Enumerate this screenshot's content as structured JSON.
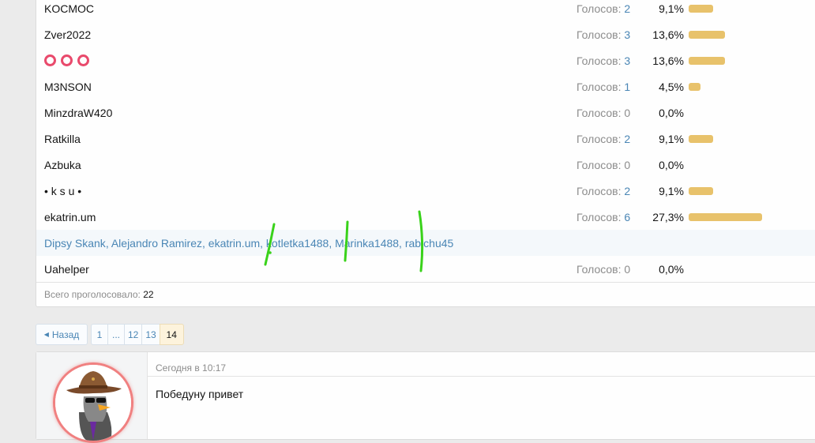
{
  "poll": {
    "votes_label": "Голосов:",
    "rows": [
      {
        "name": "KOCMOC",
        "count": "2",
        "pct": "9,1%",
        "share": 0.091
      },
      {
        "name": "Zver2022",
        "count": "3",
        "pct": "13,6%",
        "share": 0.136
      },
      {
        "name": "",
        "count": "3",
        "pct": "13,6%",
        "share": 0.136
      },
      {
        "name": "M3NSON",
        "count": "1",
        "pct": "4,5%",
        "share": 0.045
      },
      {
        "name": "MinzdraW420",
        "count": "0",
        "pct": "0,0%",
        "share": 0
      },
      {
        "name": "Ratkilla",
        "count": "2",
        "pct": "9,1%",
        "share": 0.091
      },
      {
        "name": "Azbuka",
        "count": "0",
        "pct": "0,0%",
        "share": 0
      },
      {
        "name": "• k s u •",
        "count": "2",
        "pct": "9,1%",
        "share": 0.091
      },
      {
        "name": "ekatrin.um",
        "count": "6",
        "pct": "27,3%",
        "share": 0.273
      },
      {
        "name": "Uahelper",
        "count": "0",
        "pct": "0,0%",
        "share": 0
      }
    ],
    "voters": [
      "Dipsy Skank",
      "Alejandro Ramirez",
      "ekatrin.um",
      "kotletka1488",
      "Marinka1488",
      "rabichu45"
    ],
    "total_label": "Всего проголосовало:",
    "total": "22",
    "colors": {
      "bar": "#e8c26b",
      "circles": "#e94a6c",
      "link": "#4a86b5"
    }
  },
  "pager": {
    "prev_label": "Назад",
    "prev_icon": "triangle-left-icon",
    "pages": [
      "1",
      "...",
      "12",
      "13",
      "14"
    ],
    "current": "14"
  },
  "post": {
    "date": "Сегодня в 10:17",
    "text": "Победуну привет"
  }
}
